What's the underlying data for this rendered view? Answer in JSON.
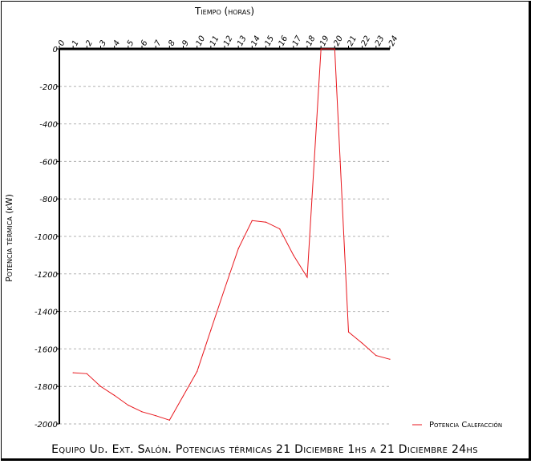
{
  "chart_data": {
    "type": "line",
    "title": "Equipo Ud. Ext. Salón. Potencias térmicas 21 Diciembre 1hs a 21 Diciembre 24hs",
    "xlabel": "Tiempo (horas)",
    "ylabel": "Potencia térmica (kW)",
    "xlim": [
      0,
      24
    ],
    "ylim": [
      -2000,
      0
    ],
    "x_ticks": [
      "0",
      "1",
      "2",
      "3",
      "4",
      "5",
      "6",
      "7",
      "8",
      "9",
      "10",
      "11",
      "12",
      "13",
      "14",
      "15",
      "16",
      "17",
      "18",
      "19",
      "20",
      "21",
      "22",
      "23",
      "24"
    ],
    "y_ticks": [
      {
        "value": 0,
        "label": "0"
      },
      {
        "value": -200,
        "label": "-200"
      },
      {
        "value": -400,
        "label": "-400"
      },
      {
        "value": -600,
        "label": "-600"
      },
      {
        "value": -800,
        "label": "-800"
      },
      {
        "value": -1000,
        "label": "-1000"
      },
      {
        "value": -1200,
        "label": "-1200"
      },
      {
        "value": -1400,
        "label": "-1400"
      },
      {
        "value": -1600,
        "label": "-1600"
      },
      {
        "value": -1800,
        "label": "-1800"
      },
      {
        "value": -2000,
        "label": "-2000"
      }
    ],
    "grid": true,
    "legend_position": "bottom-right",
    "series": [
      {
        "name": "Potencia Calefacción",
        "color": "#e8161c",
        "x": [
          1,
          2,
          3,
          4,
          5,
          6,
          7,
          8,
          9,
          10,
          11,
          12,
          13,
          14,
          15,
          16,
          17,
          18,
          19,
          20,
          21,
          22,
          23,
          24
        ],
        "values": [
          -1727,
          -1732,
          -1800,
          -1848,
          -1900,
          -1935,
          -1956,
          -1980,
          -1850,
          -1720,
          -1500,
          -1280,
          -1065,
          -916,
          -924,
          -960,
          -1100,
          -1218,
          0,
          0,
          -1510,
          -1570,
          -1635,
          -1655
        ]
      }
    ]
  }
}
